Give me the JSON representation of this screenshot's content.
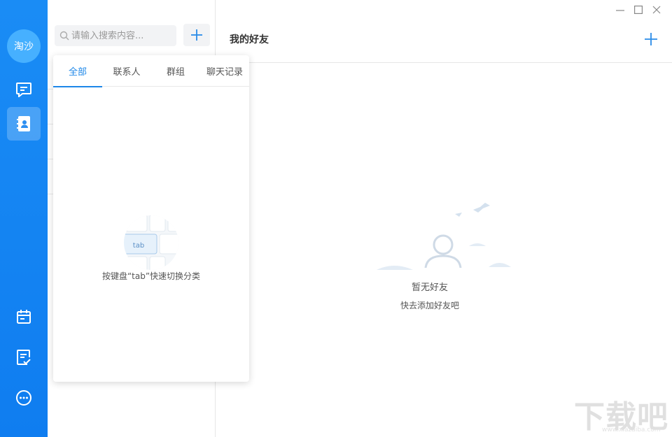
{
  "nav": {
    "avatar_text": "淘沙",
    "items": [
      {
        "icon": "chat-icon"
      },
      {
        "icon": "contacts-icon",
        "active": true
      },
      {
        "icon": "calendar-icon"
      },
      {
        "icon": "task-check-icon"
      },
      {
        "icon": "more-icon"
      }
    ]
  },
  "search": {
    "placeholder": "请输入搜索内容..."
  },
  "popup": {
    "tabs": [
      {
        "label": "全部",
        "active": true
      },
      {
        "label": "联系人"
      },
      {
        "label": "群组"
      },
      {
        "label": "聊天记录"
      }
    ],
    "key_label": "tab",
    "hint": "按键盘“tab”快速切换分类"
  },
  "main": {
    "title": "我的好友",
    "empty_title": "暂无好友",
    "empty_subtitle": "快去添加好友吧"
  },
  "watermark": {
    "text_cn": "下载吧",
    "text_en": "www.xiazaiba.com"
  },
  "colors": {
    "nav_bg": "#1a8cf5",
    "accent": "#1d87e8"
  }
}
